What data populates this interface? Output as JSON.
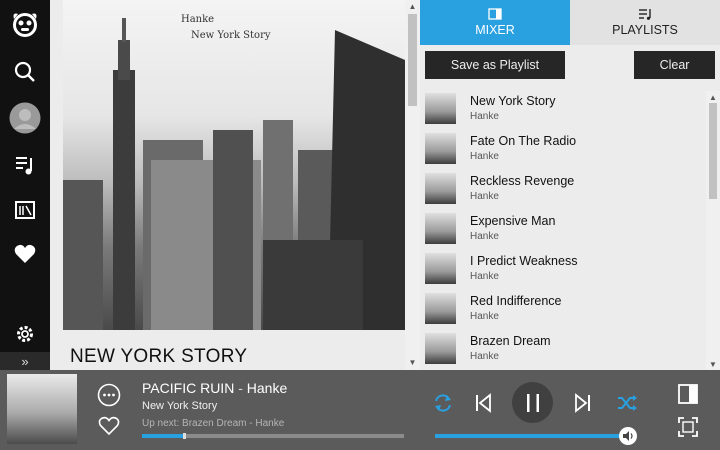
{
  "colors": {
    "accent": "#29a0e0",
    "nav_bg": "#111111",
    "player_bg": "#5b5b5b"
  },
  "nav": {
    "items": [
      {
        "icon": "napster-logo-icon"
      },
      {
        "icon": "search-icon"
      },
      {
        "icon": "avatar"
      },
      {
        "icon": "music-library-icon"
      },
      {
        "icon": "radio-icon"
      },
      {
        "icon": "heart-icon"
      },
      {
        "icon": "gear-icon"
      }
    ],
    "expand_label": "»"
  },
  "album": {
    "cover_artist": "Hanke",
    "cover_album": "New York Story",
    "title": "NEW YORK STORY"
  },
  "tabs": [
    {
      "label": "MIXER",
      "icon": "mixer-icon",
      "active": true
    },
    {
      "label": "PLAYLISTS",
      "icon": "playlist-icon",
      "active": false
    }
  ],
  "actions": {
    "save_label": "Save as Playlist",
    "clear_label": "Clear"
  },
  "tracks": [
    {
      "title": "New York Story",
      "artist": "Hanke"
    },
    {
      "title": "Fate On The Radio",
      "artist": "Hanke"
    },
    {
      "title": "Reckless Revenge",
      "artist": "Hanke"
    },
    {
      "title": "Expensive Man",
      "artist": "Hanke"
    },
    {
      "title": "I Predict Weakness",
      "artist": "Hanke"
    },
    {
      "title": "Red Indifference",
      "artist": "Hanke"
    },
    {
      "title": "Brazen Dream",
      "artist": "Hanke"
    }
  ],
  "player": {
    "track": "PACIFIC RUIN",
    "separator": " - ",
    "artist": "Hanke",
    "album": "New York Story",
    "up_next": "Up next: Brazen Dream - Hanke",
    "progress": 0.155,
    "volume": 0.98
  }
}
